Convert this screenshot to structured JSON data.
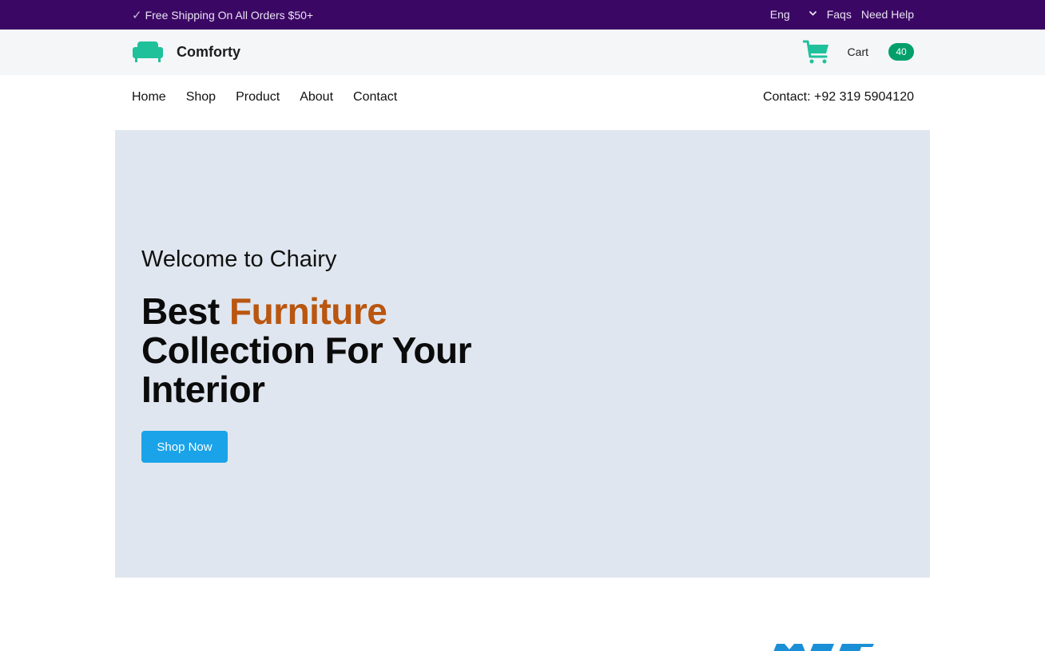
{
  "topbar": {
    "shipping_icon": "check-icon",
    "shipping_text": "Free Shipping On All Orders $50+",
    "language": "Eng",
    "faqs": "Faqs",
    "need_help": "Need Help"
  },
  "header": {
    "brand": "Comforty",
    "cart_label": "Cart",
    "cart_count": "40"
  },
  "nav": {
    "items": [
      {
        "label": "Home"
      },
      {
        "label": "Shop"
      },
      {
        "label": "Product"
      },
      {
        "label": "About"
      },
      {
        "label": "Contact"
      }
    ],
    "contact": "Contact: +92 319 5904120"
  },
  "hero": {
    "welcome": "Welcome to Chairy",
    "headline_prefix": "Best ",
    "headline_accent": "Furniture",
    "headline_rest": "Collection For Your Interior",
    "cta": "Shop Now"
  },
  "colors": {
    "topbar_bg": "#3b0764",
    "brand_green": "#029f6b",
    "logo_teal": "#1fc19b",
    "accent_orange": "#b9560f",
    "cta_blue": "#1aa3e8",
    "hero_bg": "#e0e6ef"
  }
}
